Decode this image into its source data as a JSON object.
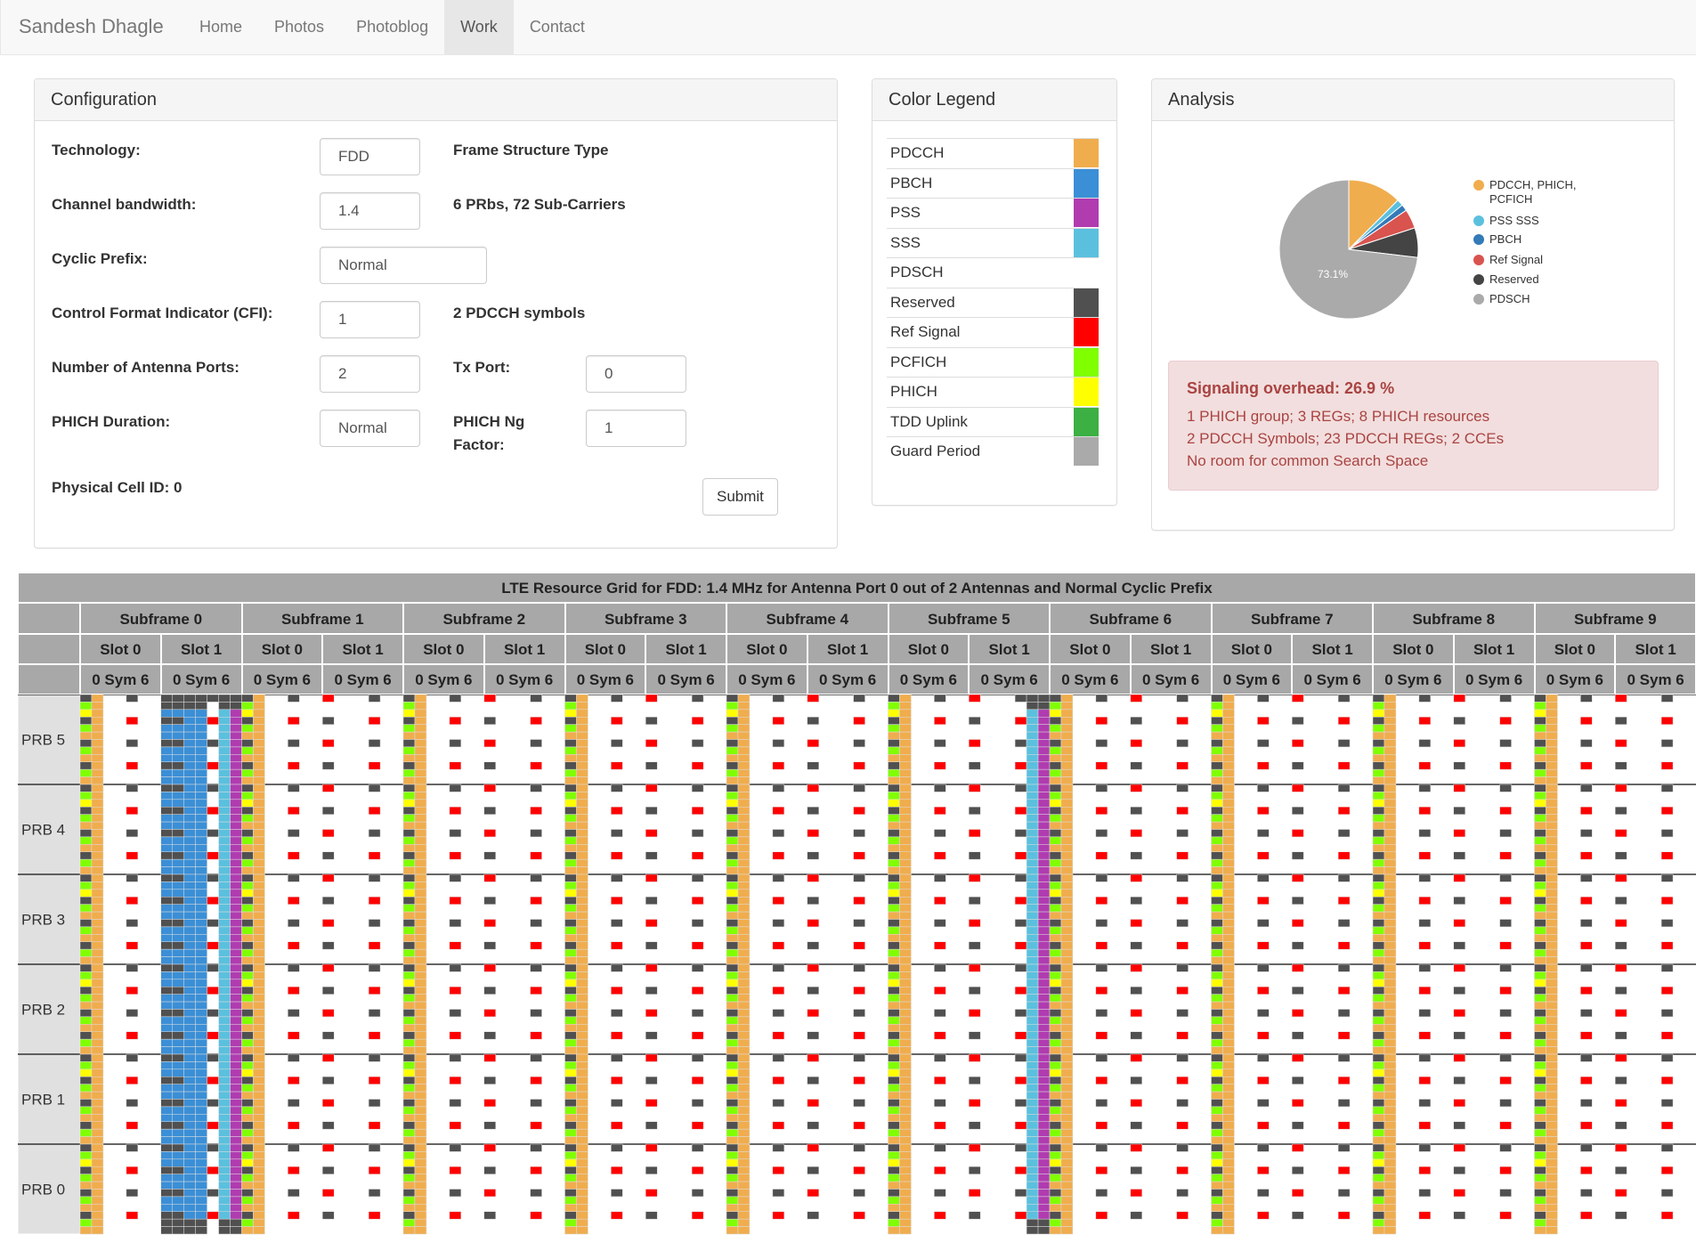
{
  "navbar": {
    "brand": "Sandesh Dhagle",
    "items": [
      "Home",
      "Photos",
      "Photoblog",
      "Work",
      "Contact"
    ],
    "active": "Work"
  },
  "config": {
    "title": "Configuration",
    "technology_label": "Technology:",
    "technology_value": "FDD",
    "frame_structure": "Frame Structure Type",
    "bandwidth_label": "Channel bandwidth:",
    "bandwidth_value": "1.4",
    "prbs_text": "6 PRbs, 72 Sub-Carriers",
    "cp_label": "Cyclic Prefix:",
    "cp_value": "Normal",
    "cfi_label": "Control Format Indicator (CFI):",
    "cfi_value": "1",
    "cfi_text": "2 PDCCH symbols",
    "antenna_label": "Number of Antenna Ports:",
    "antenna_value": "2",
    "txport_label": "Tx Port:",
    "txport_value": "0",
    "phich_dur_label": "PHICH Duration:",
    "phich_dur_value": "Normal",
    "phich_ng_label": "PHICH Ng Factor:",
    "phich_ng_value": "1",
    "cell_id": "Physical Cell ID: 0",
    "submit": "Submit"
  },
  "legend": {
    "title": "Color Legend",
    "items": [
      {
        "name": "PDCCH",
        "color": "#f0ad4e"
      },
      {
        "name": "PBCH",
        "color": "#3b8fd6"
      },
      {
        "name": "PSS",
        "color": "#b03cb0"
      },
      {
        "name": "SSS",
        "color": "#5bc0de"
      },
      {
        "name": "PDSCH",
        "color": "#ffffff"
      },
      {
        "name": "Reserved",
        "color": "#505050"
      },
      {
        "name": "Ref Signal",
        "color": "#ff0000"
      },
      {
        "name": "PCFICH",
        "color": "#80ff00"
      },
      {
        "name": "PHICH",
        "color": "#ffff00"
      },
      {
        "name": "TDD Uplink",
        "color": "#3cb043"
      },
      {
        "name": "Guard Period",
        "color": "#aaaaaa"
      }
    ]
  },
  "analysis": {
    "title": "Analysis",
    "alert_head": "Signaling overhead: 26.9 %",
    "lines": [
      "1 PHICH group; 3 REGs; 8 PHICH resources",
      "2 PDCCH Symbols; 23 PDCCH REGs; 2 CCEs",
      "No room for common Search Space"
    ],
    "pie_label": "73.1%"
  },
  "chart_data": {
    "type": "pie",
    "labels": [
      "PDCCH, PHICH, PCFICH",
      "PSS SSS",
      "PBCH",
      "Ref Signal",
      "Reserved",
      "PDSCH"
    ],
    "values": [
      12.5,
      1.5,
      1.5,
      4.5,
      6.9,
      73.1
    ],
    "colors": [
      "#f0ad4e",
      "#5bc0de",
      "#337ab7",
      "#d9534f",
      "#444444",
      "#aaaaaa"
    ],
    "legend_position": "right"
  },
  "grid": {
    "title": "LTE Resource Grid for FDD: 1.4 MHz for Antenna Port 0 out of 2 Antennas and Normal Cyclic Prefix",
    "subframes": [
      "Subframe 0",
      "Subframe 1",
      "Subframe 2",
      "Subframe 3",
      "Subframe 4",
      "Subframe 5",
      "Subframe 6",
      "Subframe 7",
      "Subframe 8",
      "Subframe 9"
    ],
    "slots": [
      "Slot 0",
      "Slot 1"
    ],
    "sym_label": "0 Sym 6",
    "prbs": [
      "PRB 5",
      "PRB 4",
      "PRB 3",
      "PRB 2",
      "PRB 1",
      "PRB 0"
    ]
  }
}
